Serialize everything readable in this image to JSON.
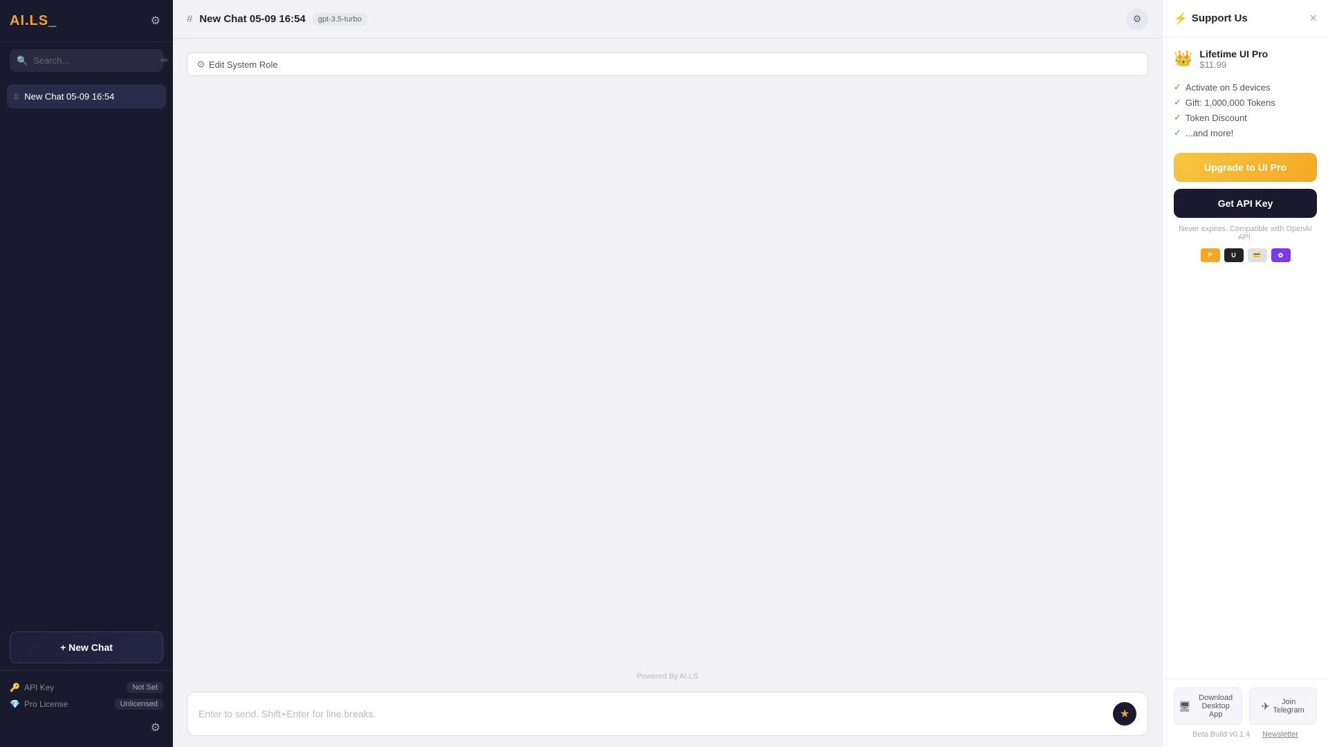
{
  "app": {
    "logo": "AI.LS",
    "logo_suffix": "_"
  },
  "sidebar": {
    "search_placeholder": "Search...",
    "chats": [
      {
        "id": "chat-1",
        "label": "New Chat 05-09 16:54",
        "active": true
      }
    ],
    "new_chat_label": "+ New Chat",
    "footer": {
      "api_key_label": "API Key",
      "api_key_value": "Not Set",
      "pro_license_label": "Pro License",
      "pro_license_value": "Unlicensed"
    }
  },
  "topbar": {
    "hash": "#",
    "title": "New Chat 05-09 16:54",
    "model": "gpt-3.5-turbo"
  },
  "chat": {
    "system_role_btn": "Edit System Role",
    "powered_by": "Powered By AI.LS",
    "input_placeholder": "Enter to send. Shift+Enter for line breaks."
  },
  "support_panel": {
    "title": "Support Us",
    "plan": {
      "name": "Lifetime UI Pro",
      "price": "$11.99"
    },
    "features": [
      "Activate on 5 devices",
      "Gift: 1,000,000 Tokens",
      "Token Discount",
      "...and more!"
    ],
    "upgrade_btn": "Upgrade to UI Pro",
    "api_key_btn": "Get API Key",
    "never_expires": "Never expires. Compatible with OpenAI API.",
    "footer": {
      "download_label": "Download",
      "desktop_app_label": "Desktop App",
      "join_label": "Join",
      "telegram_label": "Telegram",
      "beta": "Beta Build v0.1.4",
      "separator": "·",
      "newsletter": "Newsletter"
    }
  },
  "icons": {
    "bolt": "⚡",
    "crown": "👑",
    "check": "✓",
    "hash": "#",
    "search": "🔍",
    "settings": "⚙",
    "compose": "✏",
    "close": "×",
    "send": "★",
    "system_role": "⊙",
    "api_key": "🔑",
    "pro_license": "💎",
    "desktop": "🖥",
    "telegram": "✈"
  }
}
